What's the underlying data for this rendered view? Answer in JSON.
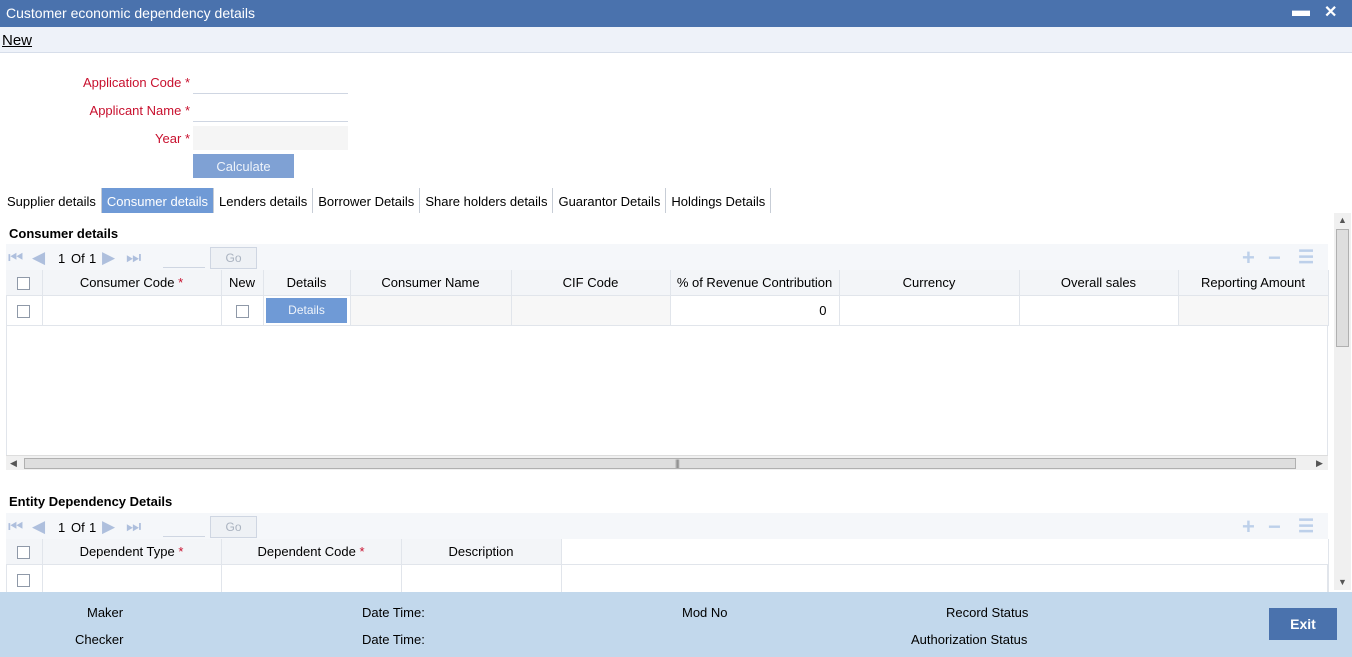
{
  "window": {
    "title": "Customer economic dependency details",
    "minimize_glyph": "▬",
    "close_glyph": "✕"
  },
  "menu": {
    "new_label": "New"
  },
  "form": {
    "application_code_label": "Application Code",
    "applicant_name_label": "Applicant Name",
    "year_label": "Year",
    "required_mark": "*",
    "calculate_label": "Calculate"
  },
  "tabs": [
    {
      "label": "Supplier details",
      "active": false
    },
    {
      "label": "Consumer details",
      "active": true
    },
    {
      "label": "Lenders details",
      "active": false
    },
    {
      "label": "Borrower Details",
      "active": false
    },
    {
      "label": "Share holders details",
      "active": false
    },
    {
      "label": "Guarantor Details",
      "active": false
    },
    {
      "label": "Holdings Details",
      "active": false
    }
  ],
  "consumer": {
    "section_title": "Consumer details",
    "pager": {
      "current": "1",
      "of_label": "Of",
      "total": "1",
      "go_label": "Go"
    },
    "columns": {
      "consumer_code": "Consumer Code",
      "new": "New",
      "details": "Details",
      "consumer_name": "Consumer Name",
      "cif_code": "CIF Code",
      "revenue_contribution": "% of Revenue Contribution",
      "currency": "Currency",
      "overall_sales": "Overall sales",
      "reporting_amount": "Reporting Amount"
    },
    "row": {
      "details_button": "Details",
      "revenue_contribution": "0"
    }
  },
  "entity": {
    "section_title": "Entity Dependency Details",
    "pager": {
      "current": "1",
      "of_label": "Of",
      "total": "1",
      "go_label": "Go"
    },
    "columns": {
      "dependent_type": "Dependent Type",
      "dependent_code": "Dependent Code",
      "description": "Description"
    }
  },
  "footer": {
    "maker": "Maker",
    "checker": "Checker",
    "date_time_1": "Date Time:",
    "date_time_2": "Date Time:",
    "mod_no": "Mod No",
    "record_status": "Record Status",
    "authorization_status": "Authorization Status",
    "exit_label": "Exit"
  },
  "colors": {
    "titlebar": "#4a72ad",
    "accent": "#6f9ad6",
    "footer": "#c2d8ec",
    "required": "#c8102e"
  }
}
